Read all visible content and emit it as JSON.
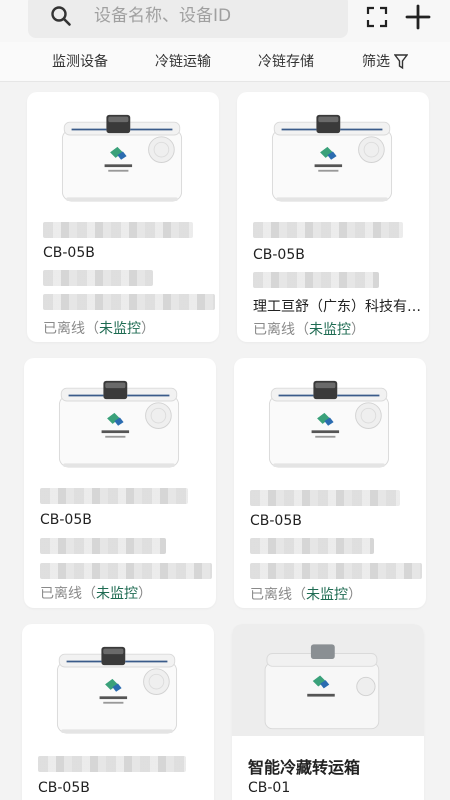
{
  "search": {
    "placeholder": "设备名称、设备ID"
  },
  "icons": {
    "search": "search-icon",
    "scan": "scan-icon",
    "add": "plus-icon",
    "filter": "funnel-icon"
  },
  "tabs": [
    {
      "label": "监测设备"
    },
    {
      "label": "冷链运输"
    },
    {
      "label": "冷链存储"
    },
    {
      "label": "筛选"
    }
  ],
  "devices": [
    {
      "model": "CB-05B",
      "company": "",
      "status": "已离线",
      "monitor": "未监控"
    },
    {
      "model": "CB-05B",
      "company": "理工亘舒（广东）科技有…",
      "status": "已离线",
      "monitor": "未监控"
    },
    {
      "model": "CB-05B",
      "company": "",
      "status": "已离线",
      "monitor": "未监控"
    },
    {
      "model": "CB-05B",
      "company": "",
      "status": "已离线",
      "monitor": "未监控"
    },
    {
      "model": "CB-05B",
      "company": "",
      "status": "",
      "monitor": ""
    },
    {
      "title": "智能冷藏转运箱",
      "model": "CB-01"
    }
  ],
  "colors": {
    "accent": "#1e6b52",
    "muted": "#8a8a8a"
  }
}
